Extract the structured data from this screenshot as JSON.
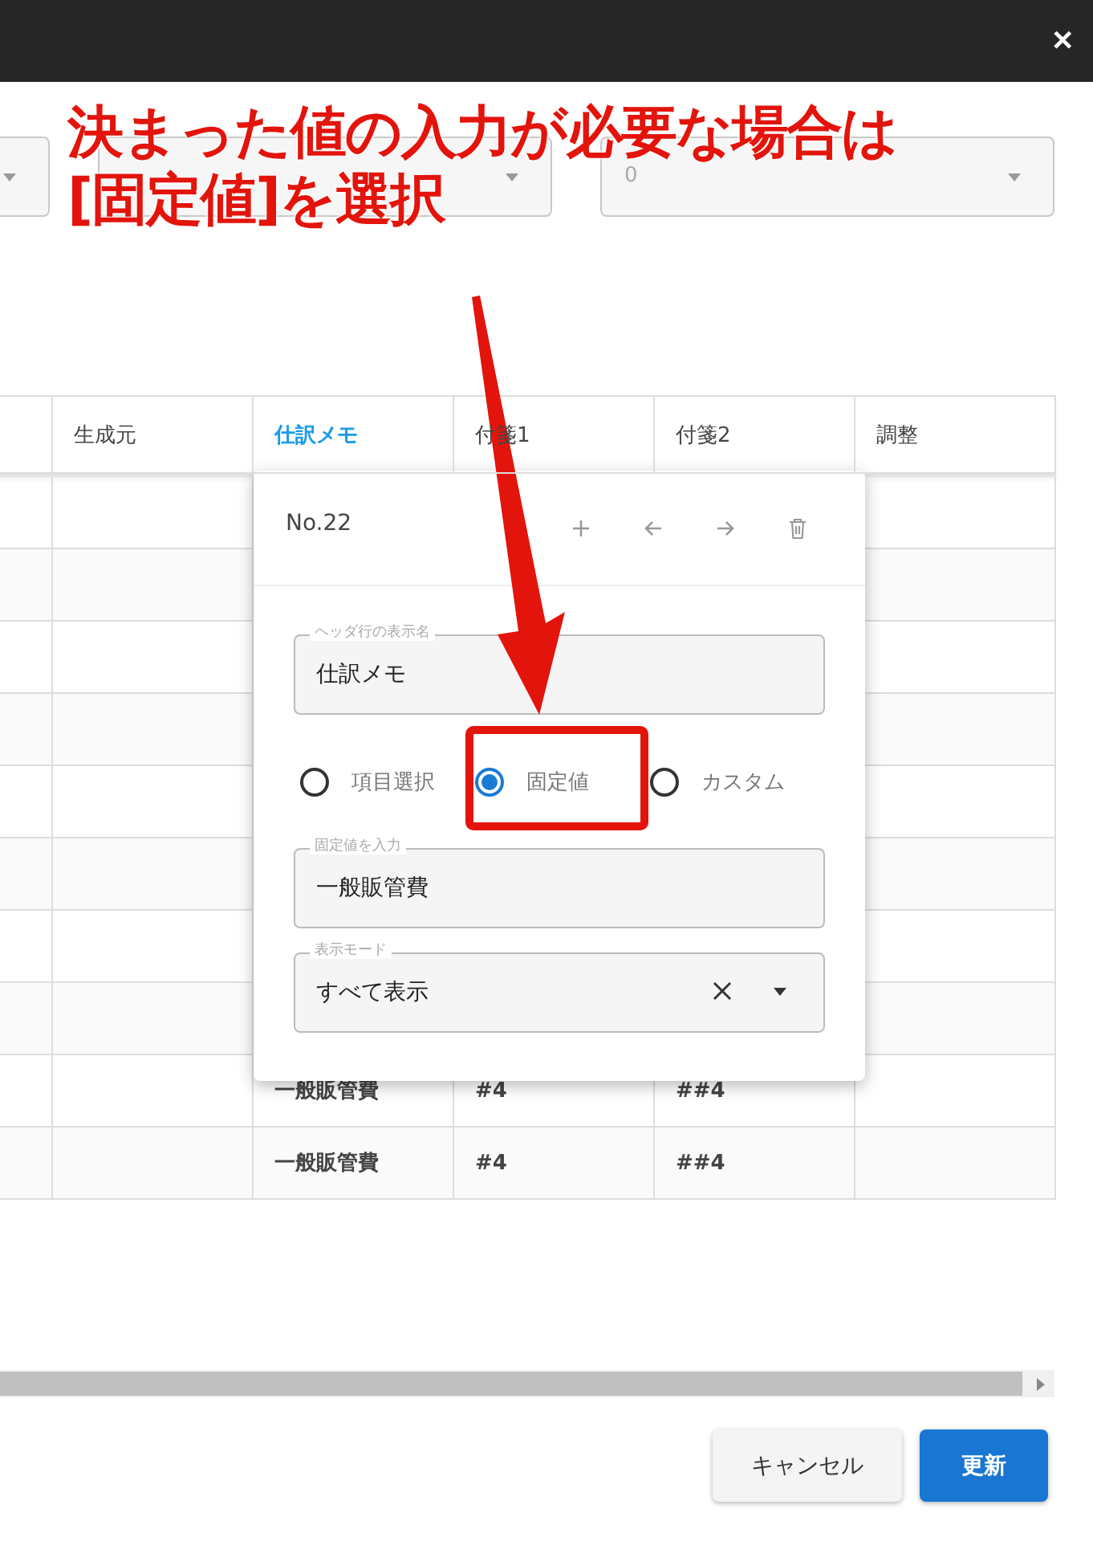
{
  "top_bar": {
    "close": "✕"
  },
  "filters": [
    {
      "kind": "partial"
    },
    {
      "kind": "select"
    },
    {
      "kind": "select",
      "value": "0",
      "disabled": true
    }
  ],
  "annotation": {
    "lines": [
      "決まった値の入力が必要な場合は",
      "[固定値]を選択"
    ]
  },
  "table": {
    "columns": [
      {
        "label": "生成元",
        "selected": false
      },
      {
        "label": "仕訳メモ",
        "selected": true
      },
      {
        "label": "付箋1",
        "selected": false
      },
      {
        "label": "付箋2",
        "selected": false
      },
      {
        "label": "調整",
        "selected": false
      }
    ],
    "rows": [
      {
        "cells": [
          "",
          "一般販管費",
          "#4",
          "##4",
          ""
        ]
      },
      {
        "cells": [
          "",
          "一般販管費",
          "#4",
          "##4",
          ""
        ]
      }
    ]
  },
  "popup": {
    "title": "No.22",
    "header_field": {
      "label": "ヘッダ行の表示名",
      "value": "仕訳メモ"
    },
    "radios": [
      {
        "label": "項目選択",
        "selected": false
      },
      {
        "label": "固定値",
        "selected": true
      },
      {
        "label": "カスタム",
        "selected": false
      }
    ],
    "fixed_field": {
      "label": "固定値を入力",
      "value": "一般販管費"
    },
    "mode_field": {
      "label": "表示モード",
      "value": "すべて表示"
    }
  },
  "buttons": [
    {
      "label": "キャンセル",
      "kind": "secondary"
    },
    {
      "label": "更新",
      "kind": "primary"
    }
  ]
}
